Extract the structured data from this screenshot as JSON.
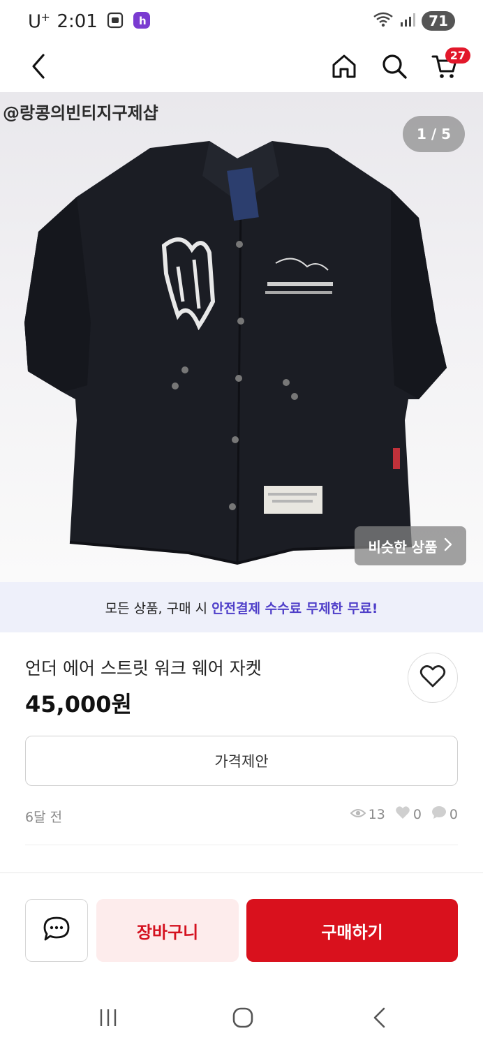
{
  "status_bar": {
    "carrier": "U",
    "carrier_sup": "+",
    "time": "2:01",
    "battery": "71"
  },
  "header": {
    "back_icon": "chevron-left-icon",
    "home_icon": "home-icon",
    "search_icon": "search-icon",
    "cart_icon": "cart-icon",
    "cart_count": "27"
  },
  "gallery": {
    "watermark": "@랑콩의빈티지구제샵",
    "page_indicator": "1 / 5",
    "similar_label": "비슷한 상품",
    "image_desc_icon": "black-work-jacket-image"
  },
  "promo": {
    "text": "모든 상품, 구매 시",
    "highlight": "안전결제 수수료 무제한 무료!"
  },
  "product": {
    "title": "언더 에어 스트릿 워크 웨어 자켓",
    "price": "45,000원",
    "offer_label": "가격제안",
    "posted": "6달 전",
    "views": "13",
    "likes": "0",
    "chats": "0"
  },
  "actions": {
    "chat_icon": "chat-icon",
    "cart_label": "장바구니",
    "buy_label": "구매하기"
  },
  "colors": {
    "brand_red": "#d9111d",
    "promo_purple": "#4f3fc9",
    "promo_bg": "#eef0fa"
  }
}
